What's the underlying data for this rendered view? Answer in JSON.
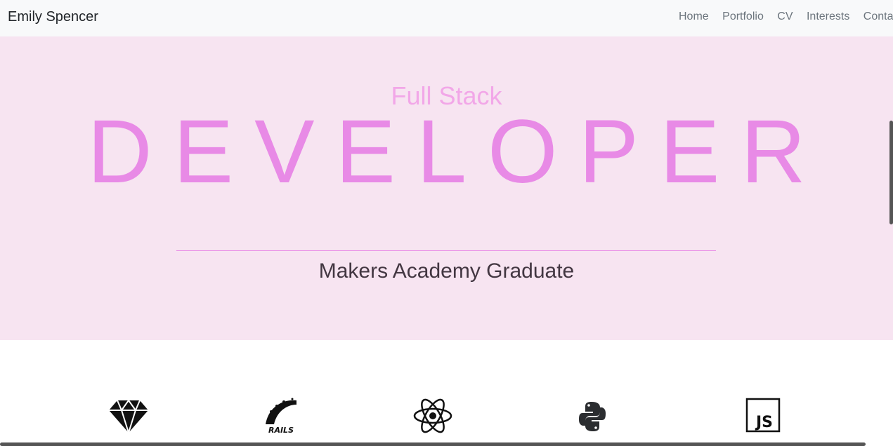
{
  "navbar": {
    "brand": "Emily Spencer",
    "links": [
      "Home",
      "Portfolio",
      "CV",
      "Interests",
      "Contac"
    ]
  },
  "hero": {
    "kicker": "Full Stack",
    "headline": "DEVELOPER",
    "subtitle": "Makers Academy Graduate",
    "colors": {
      "background": "#f7e4f1",
      "headline": "#e88ae6",
      "kicker": "#f2a7e8",
      "subtitle": "#433742"
    }
  },
  "skills": {
    "icons": [
      "ruby-icon",
      "rails-icon",
      "react-icon",
      "python-icon",
      "javascript-icon"
    ],
    "rails_text": "RAILS",
    "js_text": "JS"
  }
}
